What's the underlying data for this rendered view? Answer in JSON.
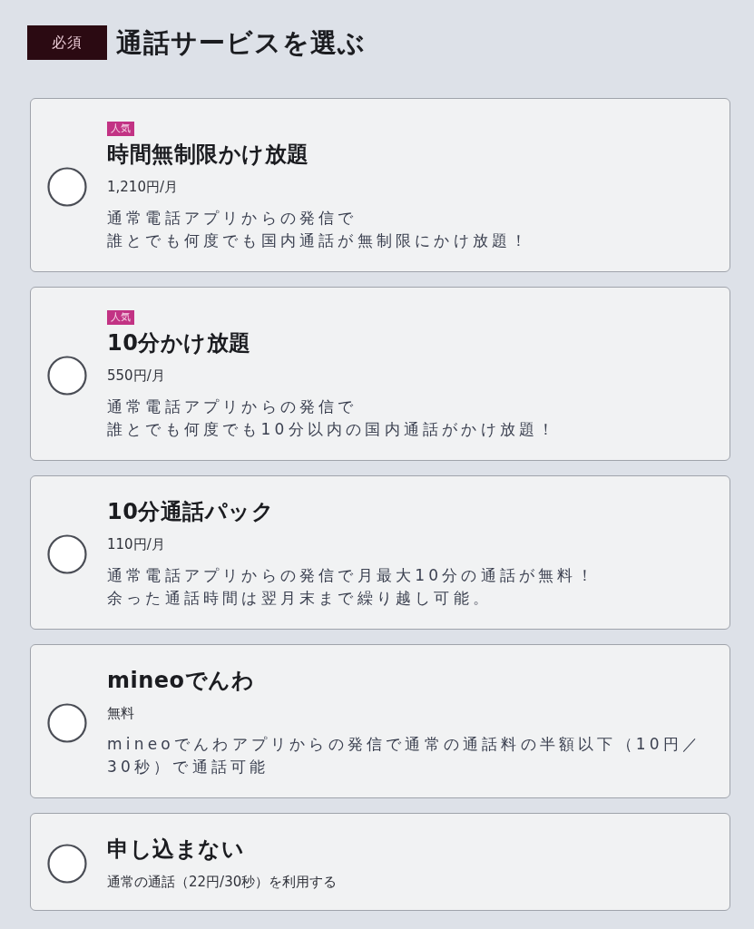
{
  "header": {
    "badge": "必須",
    "title": "通話サービスを選ぶ"
  },
  "options": [
    {
      "badge": "人気",
      "title": "時間無制限かけ放題",
      "price": "1,210円/月",
      "description": [
        "通常電話アプリからの発信で",
        "誰とでも何度でも国内通話が無制限にかけ放題！"
      ],
      "selected": false
    },
    {
      "badge": "人気",
      "title": "10分かけ放題",
      "price": "550円/月",
      "description": [
        "通常電話アプリからの発信で",
        "誰とでも何度でも10分以内の国内通話がかけ放題！"
      ],
      "selected": false
    },
    {
      "title": "10分通話パック",
      "price": "110円/月",
      "description": [
        "通常電話アプリからの発信で月最大10分の通話が無料！",
        "余った通話時間は翌月末まで繰り越し可能。"
      ],
      "selected": false
    },
    {
      "title": "mineoでんわ",
      "price": "無料",
      "description": [
        "mineoでんわアプリからの発信で通常の通話料の半額以下（10円／",
        "30秒）で通話可能"
      ],
      "selected": false
    },
    {
      "title": "申し込まない",
      "price": "通常の通話（22円/30秒）を利用する",
      "selected": false
    }
  ]
}
